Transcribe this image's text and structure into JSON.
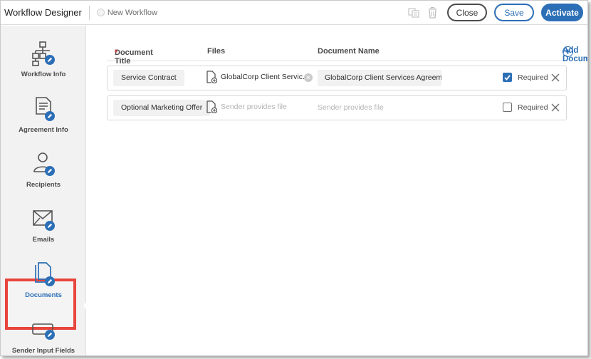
{
  "header": {
    "app_title": "Workflow Designer",
    "workflow_name": "New Workflow",
    "buttons": {
      "close": "Close",
      "save": "Save",
      "activate": "Activate"
    }
  },
  "sidebar": {
    "items": [
      {
        "label": "Workflow Info",
        "icon": "workflow-info-icon"
      },
      {
        "label": "Agreement Info",
        "icon": "agreement-info-icon"
      },
      {
        "label": "Recipients",
        "icon": "recipients-icon"
      },
      {
        "label": "Emails",
        "icon": "emails-icon"
      },
      {
        "label": "Documents",
        "icon": "documents-icon",
        "active": true
      },
      {
        "label": "Sender Input Fields",
        "icon": "sender-input-fields-icon"
      }
    ]
  },
  "documents": {
    "columns": {
      "title": "Document Title",
      "title_required_mark": "*",
      "files": "Files",
      "name": "Document Name"
    },
    "add_label": "Add Document",
    "rows": [
      {
        "title": "Service Contract",
        "file": "GlobalCorp Client Servic...",
        "name": "GlobalCorp Client Services Agreement",
        "required_label": "Required",
        "required": true
      },
      {
        "title": "Optional Marketing Offer",
        "file_placeholder": "Sender provides file",
        "name_placeholder": "Sender provides file",
        "required_label": "Required",
        "required": false
      }
    ]
  },
  "colors": {
    "accent": "#2c6fb6",
    "highlight": "#e8453c",
    "sidebar_bg": "#f2f2f2"
  }
}
